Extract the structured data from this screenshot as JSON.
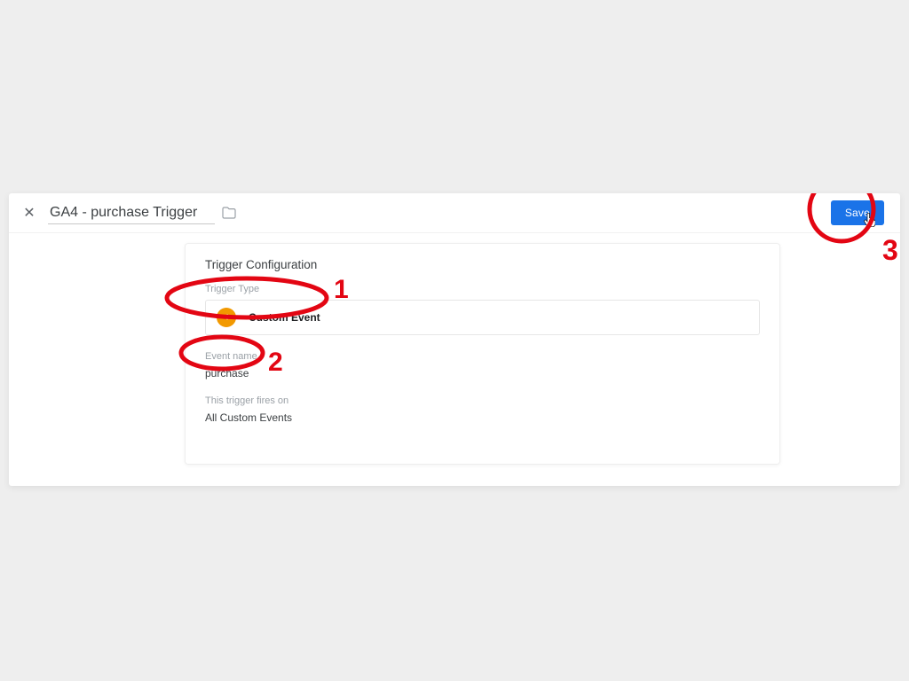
{
  "header": {
    "title_value": "GA4 - purchase Trigger",
    "save_label": "Save"
  },
  "card": {
    "heading": "Trigger Configuration",
    "trigger_type_label": "Trigger Type",
    "trigger_type_name": "Custom Event",
    "trigger_type_glyph": "<>",
    "event_name_label": "Event name",
    "event_name_value": "purchase",
    "fires_on_label": "This trigger fires on",
    "fires_on_value": "All Custom Events"
  },
  "annotations": {
    "one": "1",
    "two": "2",
    "three": "3",
    "color": "#e30613"
  }
}
